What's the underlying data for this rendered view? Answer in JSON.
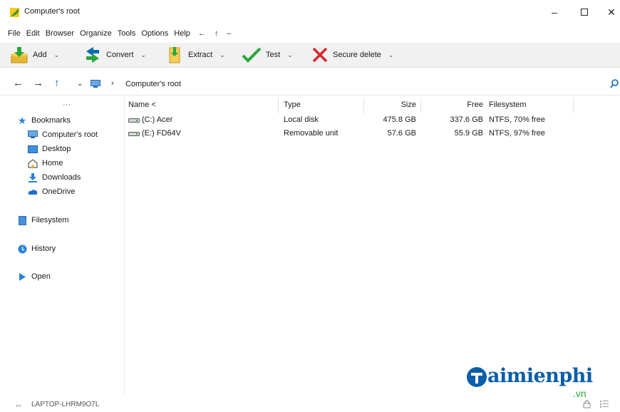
{
  "window": {
    "title": "Computer's root"
  },
  "menu": {
    "items": [
      "File",
      "Edit",
      "Browser",
      "Organize",
      "Tools",
      "Options",
      "Help"
    ],
    "symbols": [
      "←",
      "↑",
      "–"
    ]
  },
  "toolbar": {
    "add_label": "Add",
    "convert_label": "Convert",
    "extract_label": "Extract",
    "test_label": "Test",
    "secure_delete_label": "Secure delete"
  },
  "address": {
    "path": "Computer's root"
  },
  "sidebar": {
    "more": "···",
    "bookmarks": "Bookmarks",
    "items": [
      "Computer's root",
      "Desktop",
      "Home",
      "Downloads",
      "OneDrive"
    ],
    "filesystem": "Filesystem",
    "history": "History",
    "open": "Open"
  },
  "table": {
    "headers": {
      "name": "Name <",
      "type": "Type",
      "size": "Size",
      "free": "Free",
      "filesystem": "Filesystem"
    },
    "rows": [
      {
        "name": "(C:) Acer",
        "type": "Local disk",
        "size": "475.8 GB",
        "free": "337.6 GB",
        "filesystem": "NTFS, 70% free"
      },
      {
        "name": "(E:) FD64V",
        "type": "Removable unit",
        "size": "57.6 GB",
        "free": "55.9 GB",
        "filesystem": "NTFS, 97% free"
      }
    ]
  },
  "status": {
    "host": "LAPTOP-LHRM9O7L"
  },
  "watermark": {
    "brand": "aimienphi",
    "tld": ".vn"
  },
  "colors": {
    "accent": "#0a6ab5",
    "check": "#2aa63a",
    "delete": "#d8262f",
    "folder": "#e8b830"
  }
}
